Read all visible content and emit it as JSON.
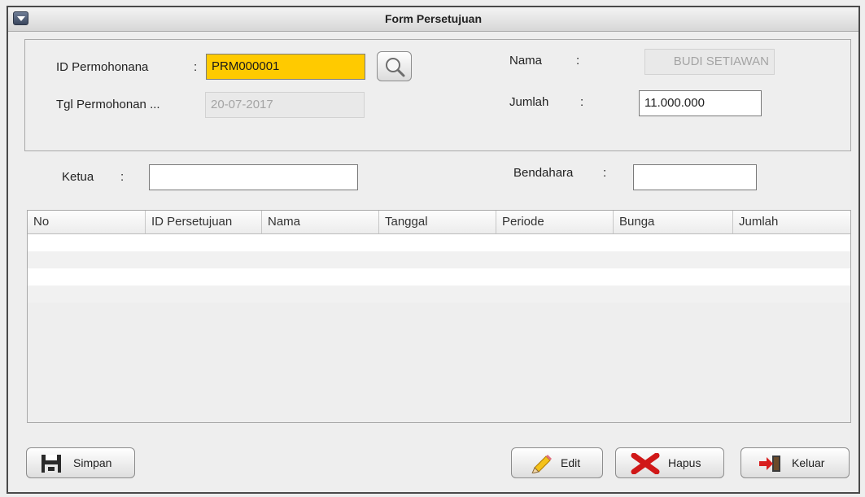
{
  "window": {
    "title": "Form Persetujuan"
  },
  "form": {
    "id_label": "ID Permohonana",
    "id_sep": ":",
    "id_value": "PRM000001",
    "tgl_label": "Tgl Permohonan ...",
    "tgl_value": "20-07-2017",
    "nama_label": "Nama",
    "nama_sep": ":",
    "nama_value": "BUDI SETIAWAN",
    "jumlah_label": "Jumlah",
    "jumlah_sep": ":",
    "jumlah_value": "11.000.000",
    "ketua_label": "Ketua",
    "ketua_sep": ":",
    "ketua_value": "",
    "bendahara_label": "Bendahara",
    "bendahara_sep": ":",
    "bendahara_value": ""
  },
  "table": {
    "columns": [
      "No",
      "ID Persetujuan",
      "Nama",
      "Tanggal",
      "Periode",
      "Bunga",
      "Jumlah"
    ],
    "rows": []
  },
  "buttons": {
    "simpan": "Simpan",
    "edit": "Edit",
    "hapus": "Hapus",
    "keluar": "Keluar"
  },
  "colors": {
    "highlight": "#ffca00",
    "delete_icon": "#d01818",
    "exit_icon": "#2f9a1e"
  }
}
